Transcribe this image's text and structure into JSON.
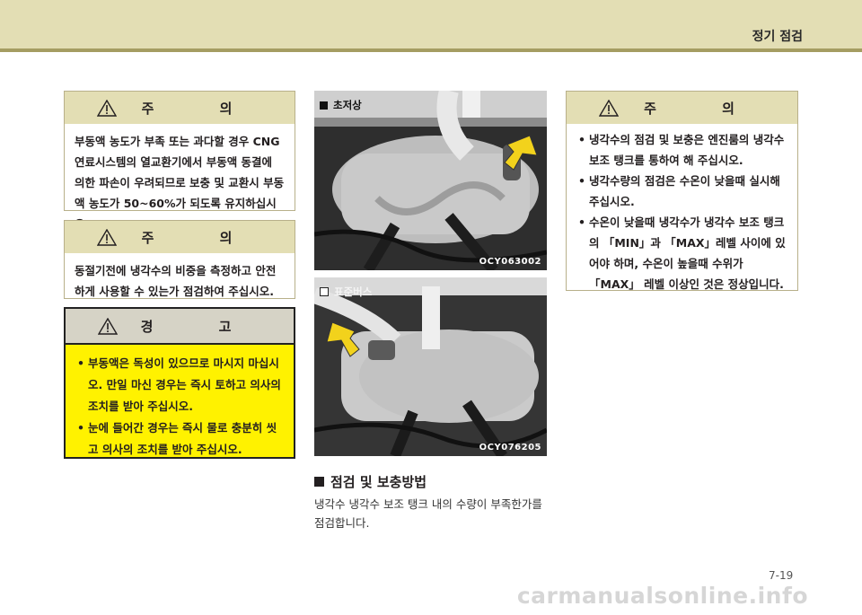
{
  "header": {
    "section_title": "정기 점검"
  },
  "caution1": {
    "title": "주 의",
    "text": "부동액 농도가 부족 또는 과다할 경우 CNG연료시스템의 열교환기에서 부동액 동결에 의한 파손이 우려되므로 보충 및 교환시 부동액 농도가 50~60%가 되도록 유지하십시오."
  },
  "caution2": {
    "title": "주 의",
    "text": "동절기전에 냉각수의 비중을 측정하고 안전하게 사용할 수 있는가 점검하여 주십시오."
  },
  "warning": {
    "title": "경 고",
    "items": [
      "부동액은 독성이 있으므로 마시지 마십시오. 만일 마신 경우는 즉시 토하고 의사의 조치를 받아 주십시오.",
      "눈에 들어간 경우는 즉시 물로 충분히 씻고 의사의 조치를 받아 주십시오."
    ]
  },
  "photo1": {
    "caption": "초저상",
    "code": "OCY063002"
  },
  "photo2": {
    "caption": "표준버스",
    "code": "OCY076205"
  },
  "method": {
    "title": "점검 및 보충방법",
    "text": "냉각수 냉각수 보조 탱크 내의 수량이 부족한가를 점검합니다."
  },
  "caution3": {
    "title": "주 의",
    "items": [
      "냉각수의 점검 및 보충은 엔진룸의 냉각수 보조 탱크를 통하여 해 주십시오.",
      "냉각수량의 점검은 수온이 낮을때 실시해 주십시오.",
      "수온이 낮을때 냉각수가 냉각수 보조 탱크의 「MIN」과 「MAX」레벨 사이에 있어야 하며, 수온이 높을때 수위가 「MAX」 레벨 이상인 것은 정상입니다."
    ]
  },
  "footer": {
    "page_number": "7-19",
    "watermark": "carmanualsonline.info"
  },
  "colors": {
    "header_band": "#e3deb4",
    "header_line": "#a59d62",
    "warning_bg": "#fff200",
    "arrow": "#f2d21c"
  }
}
